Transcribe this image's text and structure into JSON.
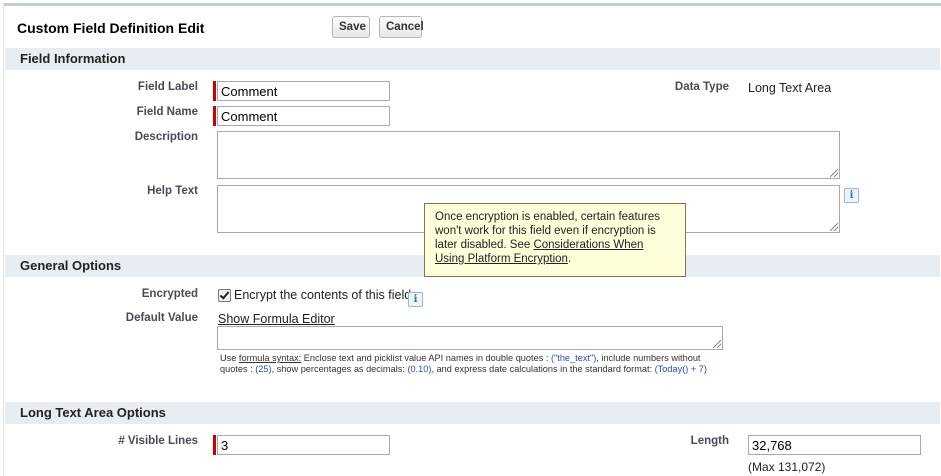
{
  "header": {
    "title": "Custom Field Definition Edit",
    "save_label": "Save",
    "cancel_label": "Cancel"
  },
  "field_information": {
    "section_title": "Field Information",
    "field_label": {
      "label": "Field Label",
      "value": "Comment"
    },
    "field_name": {
      "label": "Field Name",
      "value": "Comment"
    },
    "description": {
      "label": "Description",
      "value": ""
    },
    "help_text": {
      "label": "Help Text",
      "value": ""
    },
    "data_type": {
      "label": "Data Type",
      "value": "Long Text Area"
    }
  },
  "tooltip": {
    "text_before": "Once encryption is enabled, certain features won't work for this field even if encryption is later disabled. See ",
    "link_text": "Considerations When Using Platform Encryption",
    "text_after": "."
  },
  "general_options": {
    "section_title": "General Options",
    "encrypted": {
      "label": "Encrypted",
      "checkbox_label": "Encrypt the contents of this field",
      "checked": true
    },
    "default_value": {
      "label": "Default Value",
      "formula_link": "Show Formula Editor",
      "value": "",
      "help": {
        "p1": "Use ",
        "syntax_link": "formula syntax:",
        "p2": " Enclose text and picklist value API names in double quotes : ",
        "ex1": "(\"the_text\")",
        "p3": ", include numbers without quotes : ",
        "ex2": "(25)",
        "p4": ", show percentages as decimals: ",
        "ex3": "(0.10)",
        "p5": ", and express date calculations in the standard format: ",
        "ex4": "(Today() + 7)"
      }
    }
  },
  "long_text_area_options": {
    "section_title": "Long Text Area Options",
    "visible_lines": {
      "label": "# Visible Lines",
      "value": "3"
    },
    "length": {
      "label": "Length",
      "value": "32,768",
      "max_note": "(Max 131,072)"
    }
  },
  "icons": {
    "info": "info-icon",
    "checkbox": "checkmark-icon",
    "resize": "resize-handle-icon"
  },
  "colors": {
    "section_bg": "#e8edf3",
    "required": "#cc0000",
    "tooltip_bg": "#ffffdc"
  }
}
